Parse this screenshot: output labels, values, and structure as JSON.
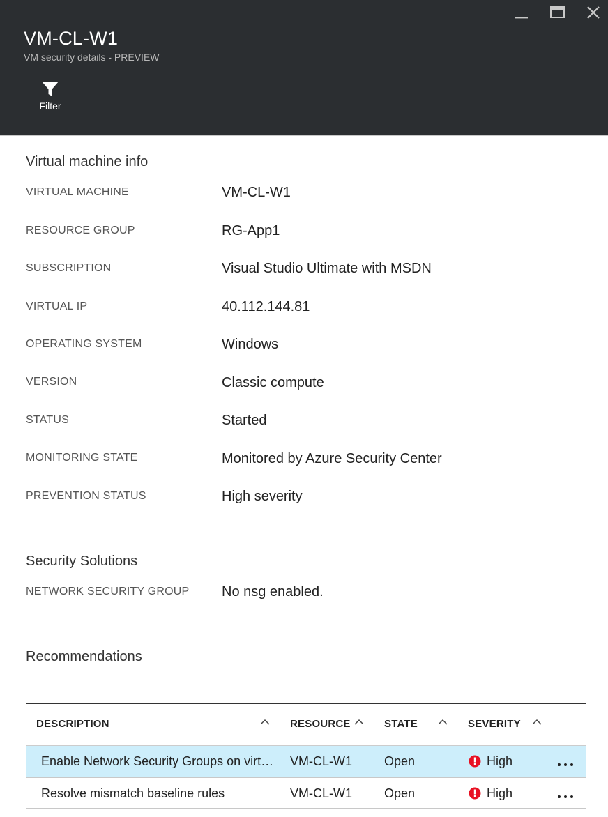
{
  "header": {
    "title": "VM-CL-W1",
    "subtitle": "VM security details - PREVIEW",
    "filter_label": "Filter",
    "background": "#2b2e31"
  },
  "window_controls": {
    "minimize_icon": "minimize-icon",
    "maximize_icon": "maximize-icon",
    "close_icon": "close-icon"
  },
  "vm_info": {
    "section_title": "Virtual machine info",
    "fields": [
      {
        "label": "VIRTUAL MACHINE",
        "value": "VM-CL-W1"
      },
      {
        "label": "RESOURCE GROUP",
        "value": "RG-App1"
      },
      {
        "label": "SUBSCRIPTION",
        "value": "Visual Studio Ultimate with MSDN"
      },
      {
        "label": "VIRTUAL IP",
        "value": "40.112.144.81"
      },
      {
        "label": "OPERATING SYSTEM",
        "value": "Windows"
      },
      {
        "label": "VERSION",
        "value": "Classic compute"
      },
      {
        "label": "STATUS",
        "value": "Started"
      },
      {
        "label": "MONITORING STATE",
        "value": "Monitored by Azure Security Center"
      },
      {
        "label": "PREVENTION STATUS",
        "value": "High severity"
      }
    ]
  },
  "security_solutions": {
    "section_title": "Security Solutions",
    "fields": [
      {
        "label": "NETWORK SECURITY GROUP",
        "value": "No nsg enabled."
      }
    ]
  },
  "recommendations": {
    "section_title": "Recommendations",
    "columns": [
      "DESCRIPTION",
      "RESOURCE",
      "STATE",
      "SEVERITY"
    ],
    "rows": [
      {
        "description": "Enable Network Security Groups on virtual machines",
        "resource": "VM-CL-W1",
        "state": "Open",
        "severity": "High",
        "selected": true
      },
      {
        "description": "Resolve mismatch baseline rules",
        "resource": "VM-CL-W1",
        "state": "Open",
        "severity": "High",
        "selected": false
      }
    ],
    "more_label": "...",
    "severity_color": "#e81123",
    "selected_row_color": "#cdeefb"
  }
}
